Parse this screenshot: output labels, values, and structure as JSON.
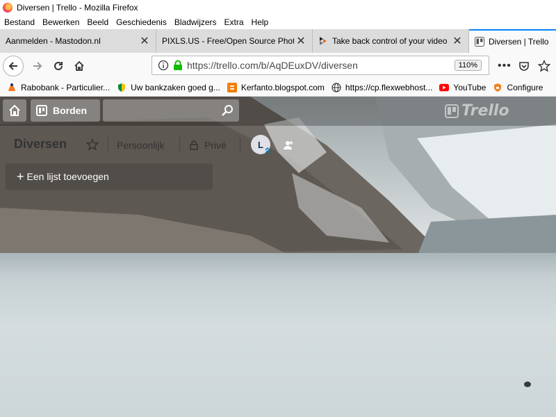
{
  "window": {
    "title": "Diversen | Trello - Mozilla Firefox"
  },
  "menu": [
    "Bestand",
    "Bewerken",
    "Beeld",
    "Geschiedenis",
    "Bladwijzers",
    "Extra",
    "Help"
  ],
  "tabs": [
    {
      "label": "Aanmelden - Mastodon.nl",
      "active": false
    },
    {
      "label": "PIXLS.US - Free/Open Source Photo",
      "active": false
    },
    {
      "label": "Take back control of your video",
      "active": false
    },
    {
      "label": "Diversen | Trello",
      "active": true
    }
  ],
  "navbar": {
    "url": "https://trello.com/b/AqDEuxDV/diversen",
    "zoom": "110%"
  },
  "bookmarks": [
    {
      "label": "Rabobank - Particulier...",
      "icon": "rabobank-icon"
    },
    {
      "label": "Uw bankzaken goed g...",
      "icon": "shield-icon"
    },
    {
      "label": "Kerfanto.blogspot.com",
      "icon": "blogger-icon"
    },
    {
      "label": "https://cp.flexwebhost...",
      "icon": "globe-icon"
    },
    {
      "label": "YouTube",
      "icon": "youtube-icon"
    },
    {
      "label": "Configure",
      "icon": "configure-icon"
    }
  ],
  "trello": {
    "header": {
      "boards_label": "Borden",
      "logo_text": "Trello"
    },
    "board": {
      "name": "Diversen",
      "team": "Persoonlijk",
      "visibility": "Privé",
      "avatar_initial": "L"
    },
    "add_list_label": "Een lijst toevoegen"
  },
  "colors": {
    "accent": "#0a84ff",
    "secure_lock": "#12bc00",
    "youtube_red": "#ff0000",
    "blogger_orange": "#f57d00"
  }
}
